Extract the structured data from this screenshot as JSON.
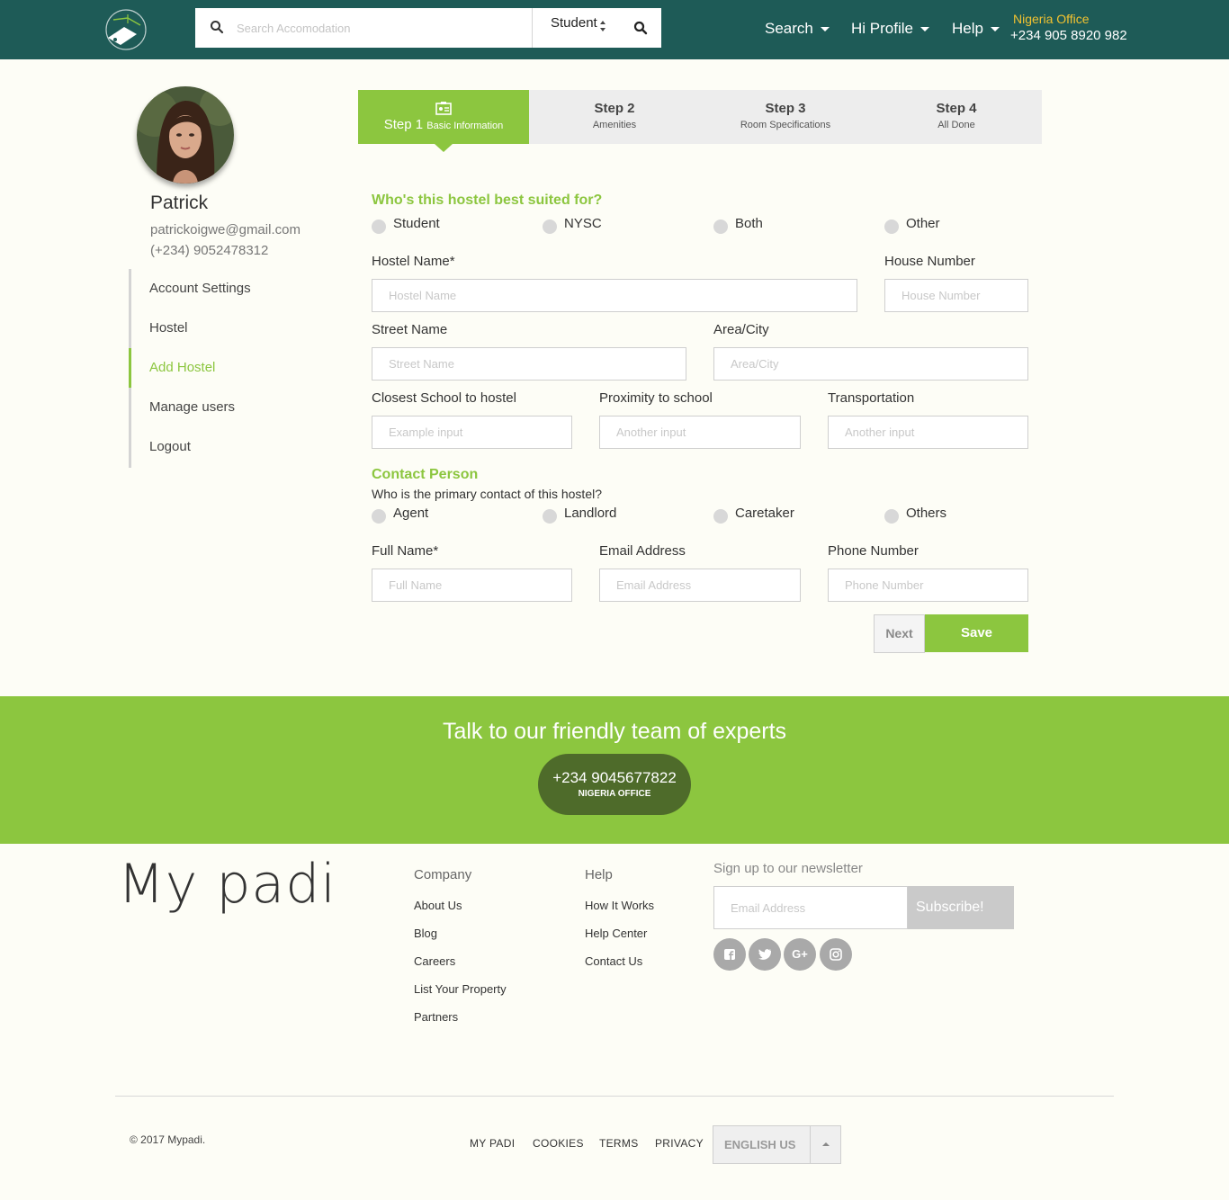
{
  "header": {
    "search_placeholder": "Search Accomodation",
    "search_type": "Student",
    "nav": [
      "Search",
      "Hi Profile",
      "Help"
    ],
    "office_title": "Nigeria Office",
    "office_phone": "+234 905 8920 982",
    "colors": {
      "bar": "#1e5b57",
      "accent": "#f2c230"
    }
  },
  "profile": {
    "name": "Patrick",
    "email": "patrickoigwe@gmail.com",
    "phone": "(+234) 9052478312",
    "menu": [
      "Account Settings",
      "Hostel",
      "Add Hostel",
      "Manage users",
      "Logout"
    ],
    "active_menu": "Add Hostel"
  },
  "steps": [
    {
      "title": "Step 1",
      "subtitle": "Basic Information"
    },
    {
      "title": "Step 2",
      "subtitle": "Amenities"
    },
    {
      "title": "Step 3",
      "subtitle": "Room Specifications"
    },
    {
      "title": "Step 4",
      "subtitle": "All Done"
    }
  ],
  "form": {
    "suited_heading": "Who's this hostel best suited for?",
    "suited_options": [
      "Student",
      "NYSC",
      "Both",
      "Other"
    ],
    "hostel_name_label": "Hostel Name*",
    "hostel_name_placeholder": "Hostel Name",
    "house_number_label": "House Number",
    "house_number_placeholder": "House Number",
    "street_label": "Street Name",
    "street_placeholder": "Street Name",
    "area_label": "Area/City",
    "area_placeholder": "Area/City",
    "school_label": "Closest School to hostel",
    "school_placeholder": "Example input",
    "proximity_label": "Proximity to school",
    "proximity_placeholder": "Another input",
    "transport_label": "Transportation",
    "transport_placeholder": "Another input",
    "contact_heading": "Contact Person",
    "contact_question": "Who is the primary contact of this hostel?",
    "contact_options": [
      "Agent",
      "Landlord",
      "Caretaker",
      "Others"
    ],
    "fullname_label": "Full Name*",
    "fullname_placeholder": "Full Name",
    "email_label": "Email Address",
    "email_placeholder": "Email Address",
    "phone_label": "Phone Number",
    "phone_placeholder": "Phone Number",
    "next_label": "Next",
    "save_label": "Save",
    "accent_color": "#8cc63f"
  },
  "cta": {
    "title": "Talk to our friendly team of experts",
    "phone": "+234 9045677822",
    "office": "NIGERIA OFFICE"
  },
  "footer": {
    "brand": "My padi",
    "company_title": "Company",
    "company_links": [
      "About Us",
      "Blog",
      "Careers",
      "List Your Property",
      "Partners"
    ],
    "help_title": "Help",
    "help_links": [
      "How It Works",
      "Help Center",
      "Contact Us"
    ],
    "newsletter_title": "Sign up to our newsletter",
    "newsletter_placeholder": "Email Address",
    "subscribe_label": "Subscribe!",
    "social": [
      "facebook-icon",
      "twitter-icon",
      "google-plus-icon",
      "instagram-icon"
    ],
    "copyright": "© 2017 Mypadi.",
    "bottom_links": [
      "MY PADI",
      "COOKIES",
      "TERMS",
      "PRIVACY"
    ],
    "language": "ENGLISH US"
  }
}
